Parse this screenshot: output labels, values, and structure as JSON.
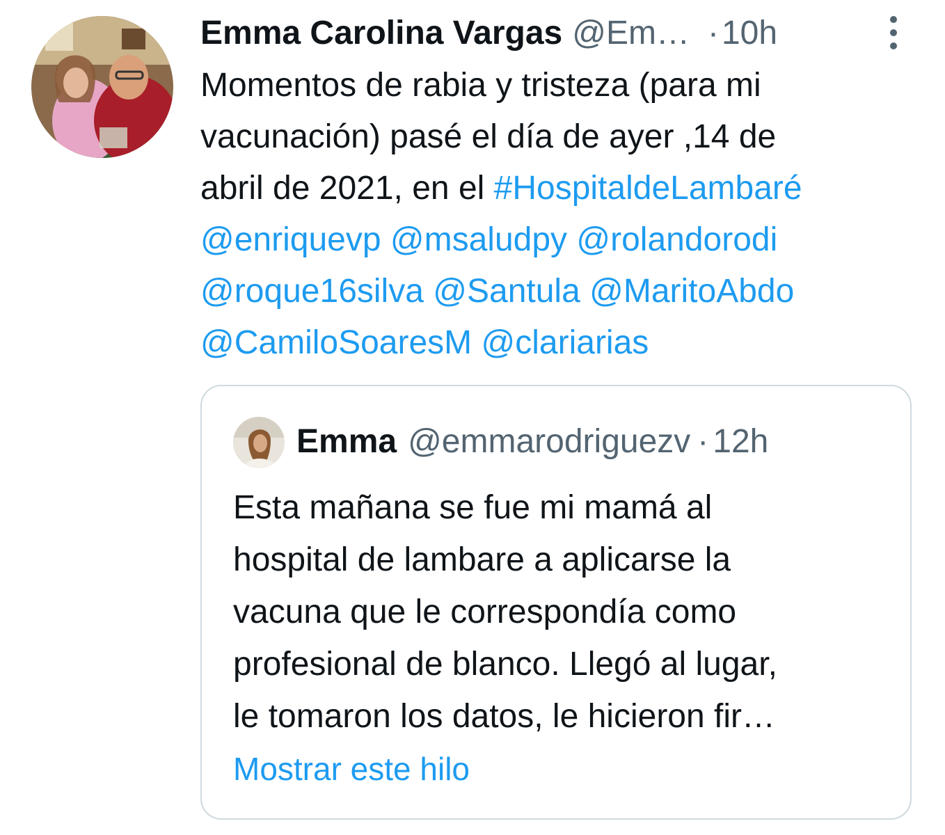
{
  "tweet": {
    "author_name": "Emma Carolina Vargas",
    "author_handle": "@Em…",
    "separator": "·",
    "time": "10h",
    "more_icon": "more-vertical-icon",
    "text_lines": [
      "Momentos de rabia y tristeza (para mi",
      "vacunación) pasé el día de ayer ,14 de"
    ],
    "line3_prefix": "abril de 2021, en el ",
    "hashtag": "#HospitaldeLambaré",
    "mentions": [
      "@enriquevp",
      "@msaludpy",
      "@rolandorodi",
      "@roque16silva",
      "@Santula",
      "@MaritoAbdo",
      "@CamiloSoaresM",
      "@clariarias"
    ]
  },
  "quote": {
    "author_name": "Emma",
    "author_handle": "@emmarodriguezv",
    "separator": "·",
    "time": "12h",
    "text_lines": [
      "Esta mañana se fue mi mamá al",
      "hospital de lambare a aplicarse la",
      "vacuna que le correspondía como",
      "profesional de blanco. Llegó al lugar,",
      "le tomaron los datos, le hicieron fir…"
    ],
    "show_thread": "Mostrar este hilo"
  },
  "colors": {
    "link": "#1d9bf0",
    "secondary_text": "#536471",
    "primary_text": "#0f1419",
    "border": "#cfd9de"
  }
}
